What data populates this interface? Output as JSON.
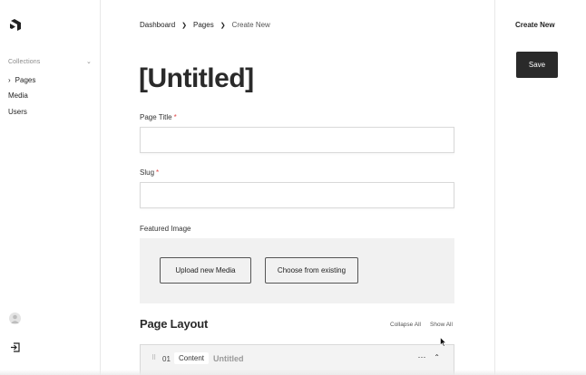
{
  "sidebar": {
    "section_label": "Collections",
    "items": [
      {
        "label": "Pages",
        "active": true
      },
      {
        "label": "Media",
        "active": false
      },
      {
        "label": "Users",
        "active": false
      }
    ]
  },
  "breadcrumb": {
    "items": [
      "Dashboard",
      "Pages"
    ],
    "current": "Create New"
  },
  "main": {
    "title": "[Untitled]",
    "fields": {
      "page_title": {
        "label": "Page Title",
        "required": "*",
        "value": ""
      },
      "slug": {
        "label": "Slug",
        "required": "*",
        "value": ""
      },
      "featured_image": {
        "label": "Featured Image",
        "upload_label": "Upload new Media",
        "choose_label": "Choose from existing"
      }
    },
    "layout": {
      "title": "Page Layout",
      "collapse_all": "Collapse All",
      "show_all": "Show All",
      "blocks": [
        {
          "number": "01",
          "type": "Content",
          "title": "Untitled"
        }
      ]
    }
  },
  "rightbar": {
    "title": "Create New",
    "save_label": "Save"
  },
  "icons": {
    "logo": "payload-logo-icon",
    "nav_arrow": "chevron-right-icon",
    "section_toggle": "chevron-down-icon",
    "avatar": "user-avatar-icon",
    "logout": "logout-icon",
    "drag": "drag-handle-icon",
    "more": "more-horizontal-icon",
    "collapse": "chevron-up-icon"
  },
  "colors": {
    "save_bg": "#2a2a2a",
    "required": "#e04848",
    "media_bg": "#f1f1f1"
  }
}
